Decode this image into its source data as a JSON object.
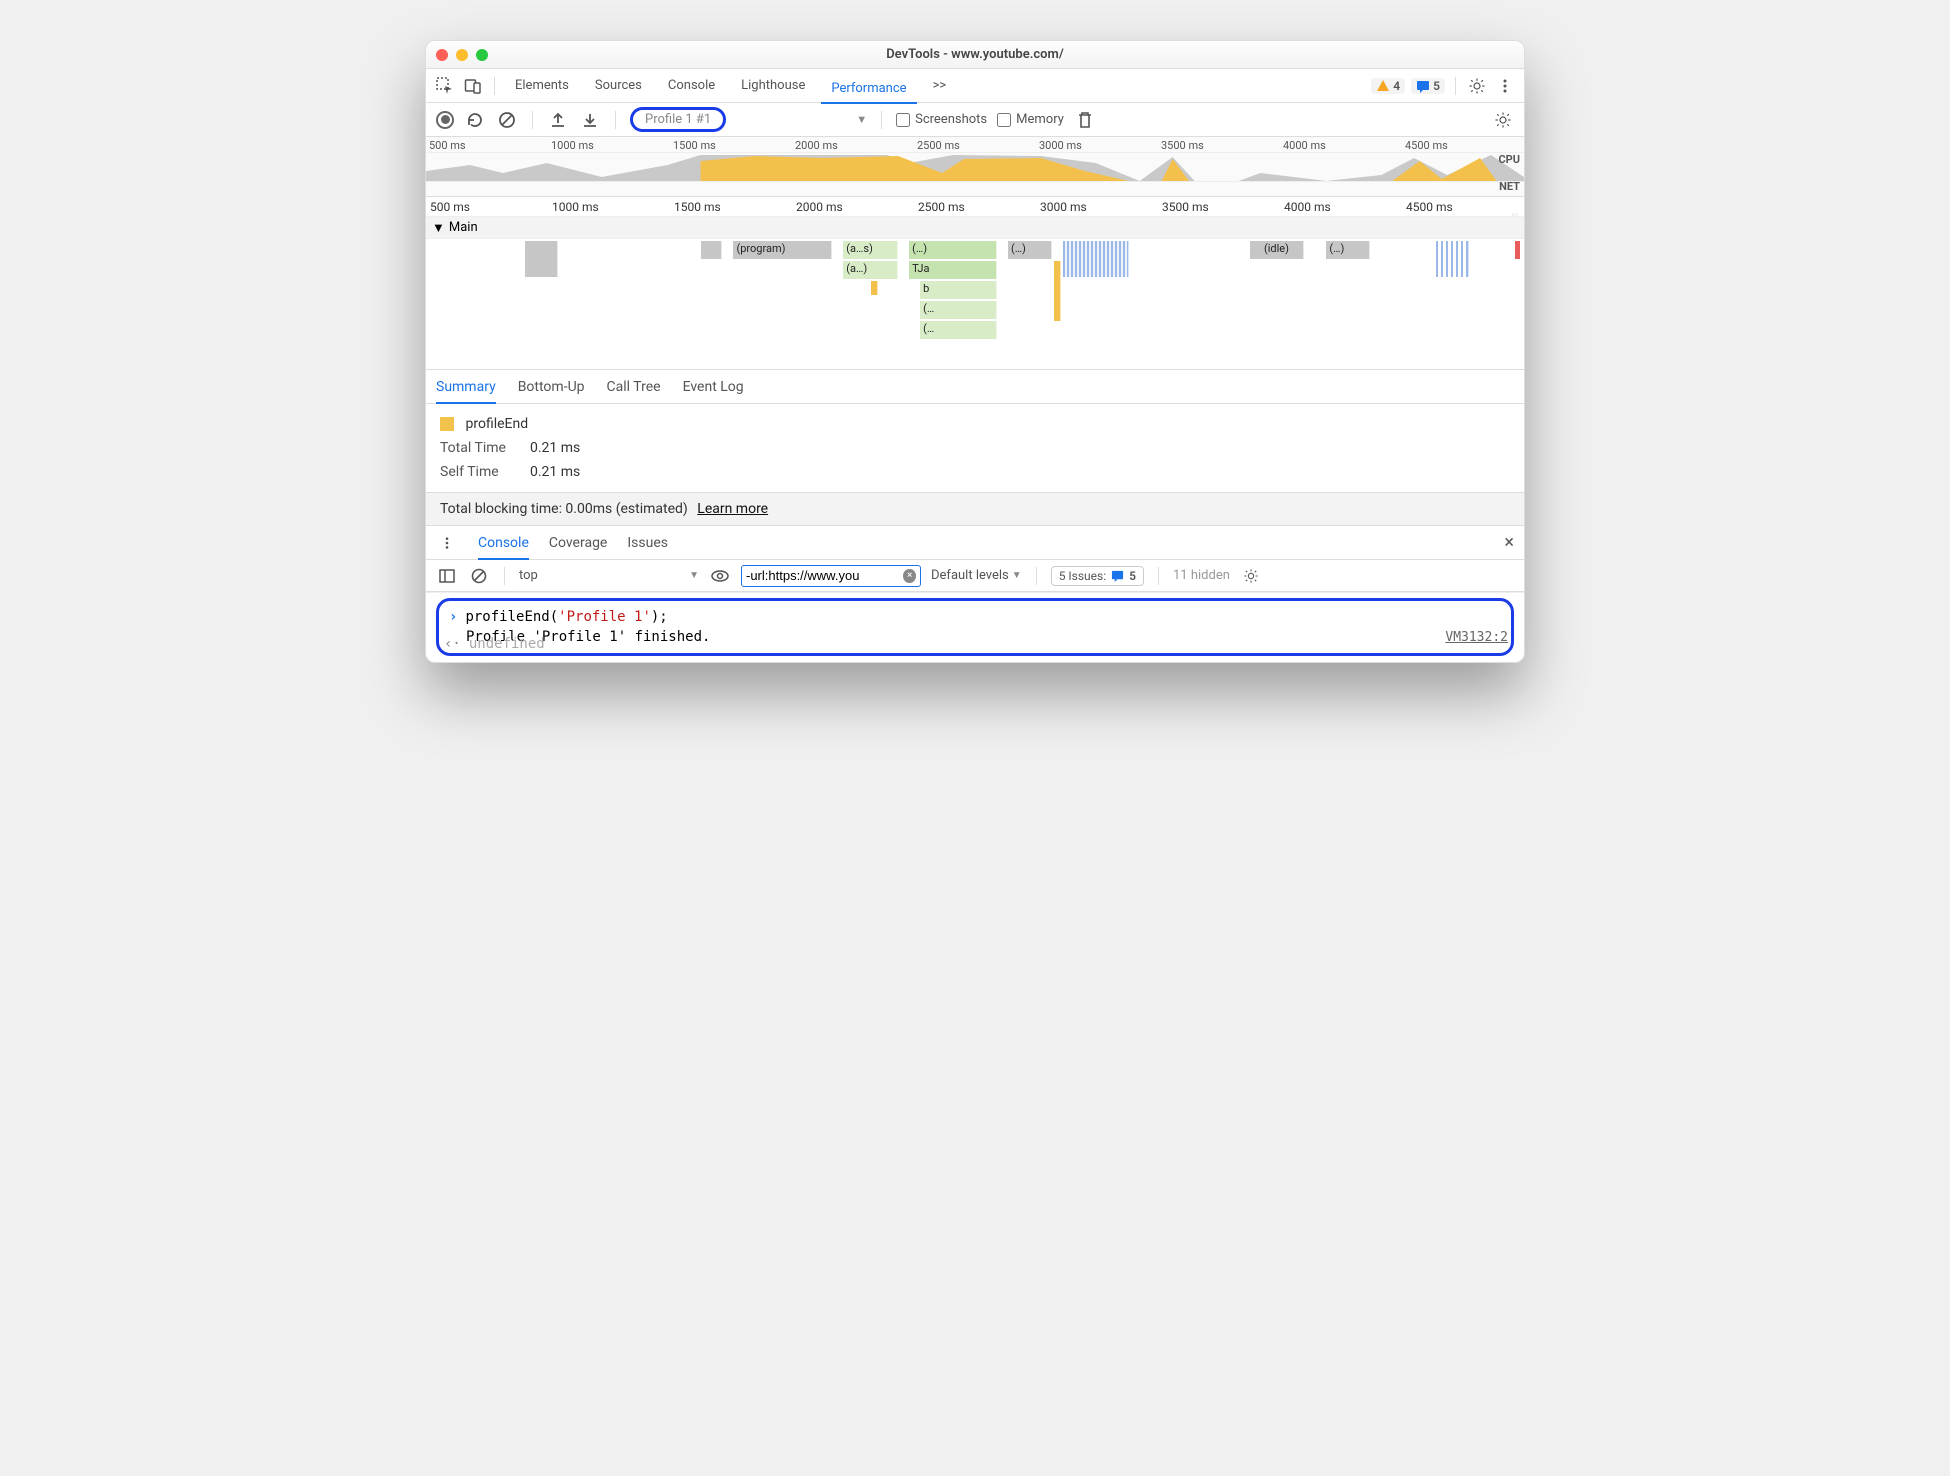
{
  "window": {
    "title": "DevTools - www.youtube.com/"
  },
  "toolbar": {
    "tabs": [
      "Elements",
      "Sources",
      "Console",
      "Lighthouse",
      "Performance"
    ],
    "active": "Performance",
    "more": ">>",
    "warnings": "4",
    "messages": "5"
  },
  "perf_toolbar": {
    "profile_name": "Profile 1 #1",
    "screenshots_label": "Screenshots",
    "memory_label": "Memory"
  },
  "ruler": [
    "500 ms",
    "1000 ms",
    "1500 ms",
    "2000 ms",
    "2500 ms",
    "3000 ms",
    "3500 ms",
    "4000 ms",
    "4500 ms"
  ],
  "lanes": {
    "cpu": "CPU",
    "net": "NET"
  },
  "main_label": "Main",
  "flame": {
    "program": "(program)",
    "a_s": "(a…s)",
    "a": "(a…)",
    "dots": "(…)",
    "idle": "(idle)",
    "tja": "TJa",
    "b": "b",
    "br1": "(…",
    "br2": "(…"
  },
  "summary_tabs": [
    "Summary",
    "Bottom-Up",
    "Call Tree",
    "Event Log"
  ],
  "summary": {
    "name": "profileEnd",
    "total_label": "Total Time",
    "total": "0.21 ms",
    "self_label": "Self Time",
    "self": "0.21 ms"
  },
  "blocking": {
    "text": "Total blocking time: 0.00ms (estimated)",
    "learn": "Learn more"
  },
  "drawer_tabs": [
    "Console",
    "Coverage",
    "Issues"
  ],
  "console_toolbar": {
    "context": "top",
    "filter": "-url:https://www.you",
    "levels": "Default levels",
    "issues_label": "5 Issues:",
    "issues_count": "5",
    "hidden": "11 hidden"
  },
  "console_body": {
    "input_prefix": "profileEnd(",
    "input_arg": "'Profile 1'",
    "input_suffix": ");",
    "output": "Profile 'Profile 1' finished.",
    "source": "VM3132:2",
    "return": "undefined"
  }
}
